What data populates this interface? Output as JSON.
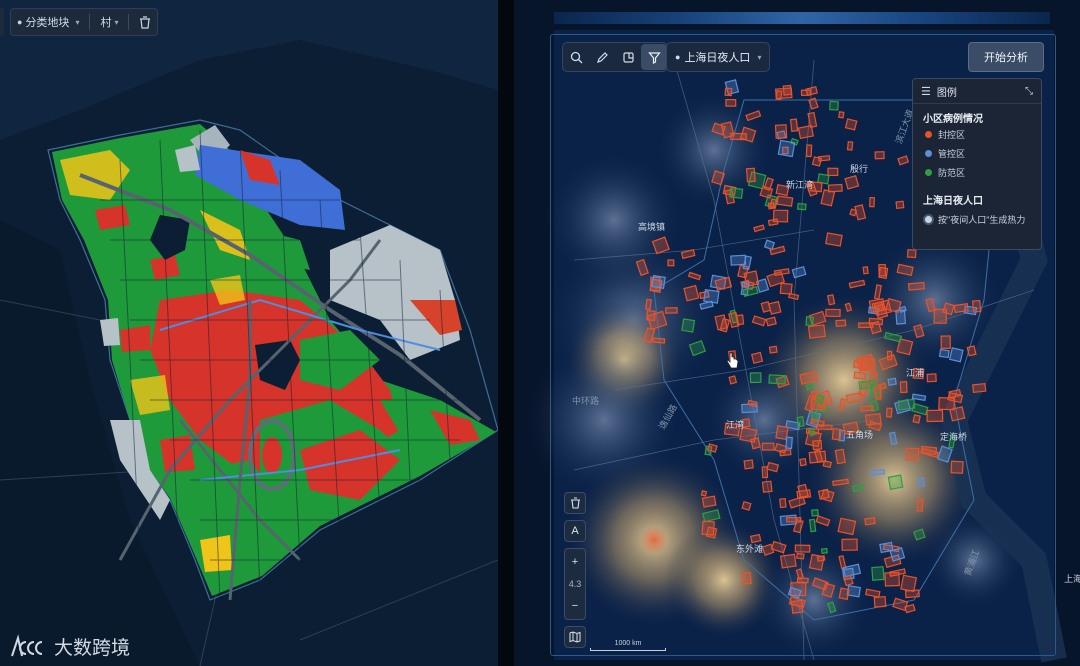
{
  "left_panel": {
    "toolbar": {
      "category_label": "分类地块",
      "level_label": "村"
    },
    "watermark": {
      "text": "大数跨境"
    }
  },
  "right_panel": {
    "layer_select": {
      "label": "上海日夜人口"
    },
    "analyze_button": {
      "label": "开始分析"
    },
    "legend": {
      "title": "图例",
      "sections": [
        {
          "title": "小区病例情况",
          "items": [
            {
              "label": "封控区",
              "color": "#e8532b"
            },
            {
              "label": "管控区",
              "color": "#5b8fd6"
            },
            {
              "label": "防范区",
              "color": "#2f9e44"
            }
          ]
        },
        {
          "title": "上海日夜人口",
          "items": [
            {
              "label": "按\"夜间人口\"生成热力"
            }
          ]
        }
      ]
    },
    "zoom": {
      "plus": "+",
      "level": "4.3",
      "minus": "−"
    },
    "text_tool": "A",
    "scale": "1000 km",
    "map_labels": [
      {
        "text": "高境镇"
      },
      {
        "text": "中环路"
      },
      {
        "text": "逸仙路"
      },
      {
        "text": "新江湾"
      },
      {
        "text": "殷行"
      },
      {
        "text": "江浦"
      },
      {
        "text": "五角场"
      },
      {
        "text": "定海桥"
      },
      {
        "text": "江湾"
      },
      {
        "text": "东外滩"
      },
      {
        "text": "黄浦江"
      },
      {
        "text": "滨江大道"
      },
      {
        "text": "上海"
      }
    ]
  }
}
